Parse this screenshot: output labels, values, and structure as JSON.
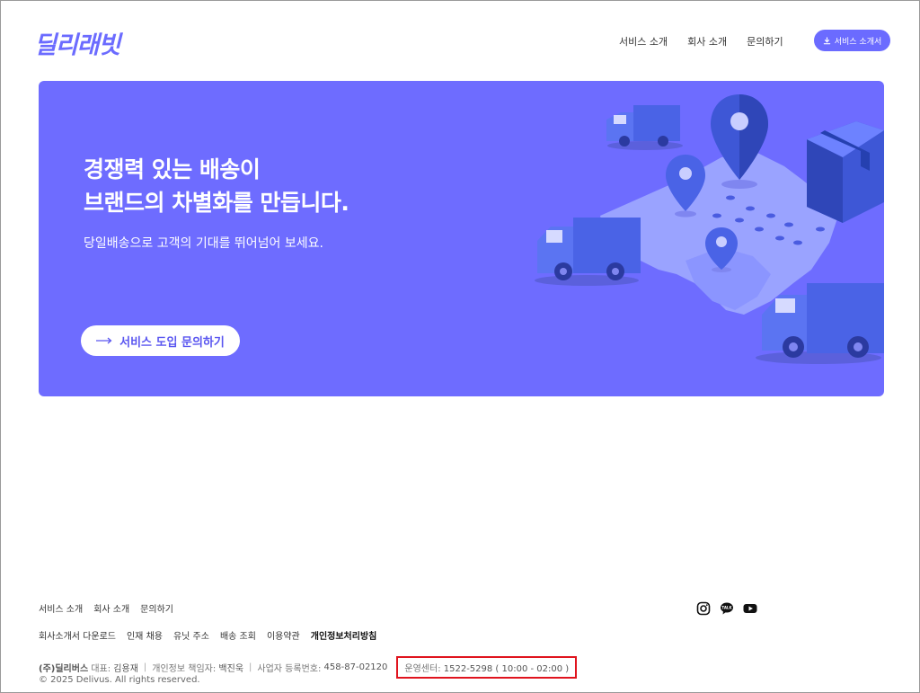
{
  "header": {
    "logo_text": "딜리래빗",
    "nav": [
      "서비스 소개",
      "회사 소개",
      "문의하기"
    ],
    "download_button": "서비스 소개서"
  },
  "hero": {
    "title_line1": "경쟁력 있는 배송이",
    "title_line2": "브랜드의 차별화를 만듭니다.",
    "subtitle": "당일배송으로 고객의 기대를 뛰어넘어 보세요.",
    "cta_label": "서비스 도입 문의하기"
  },
  "footer": {
    "links_row1": [
      "서비스 소개",
      "회사 소개",
      "문의하기"
    ],
    "links_row2": [
      "회사소개서 다운로드",
      "인재 채용",
      "유닛 주소",
      "배송 조회",
      "이용약관",
      "개인정보처리방침"
    ],
    "social_icons": [
      "instagram-icon",
      "kakaotalk-icon",
      "youtube-icon"
    ],
    "company_name": "(주)딜리버스",
    "ceo_label": "대표:",
    "ceo_name": "김용재",
    "privacy_label": "개인정보 책임자:",
    "privacy_name": "백진욱",
    "biz_label": "사업자 등록번호:",
    "biz_number": "458-87-02120",
    "ops_label": "운영센터:",
    "ops_value": "1522-5298 ( 10:00 - 02:00 )",
    "copyright": "© 2025 Delivus. All rights reserved."
  },
  "colors": {
    "brand": "#6b6bff",
    "hero_bg": "#6e6cff",
    "highlight_box": "#e0141e"
  }
}
